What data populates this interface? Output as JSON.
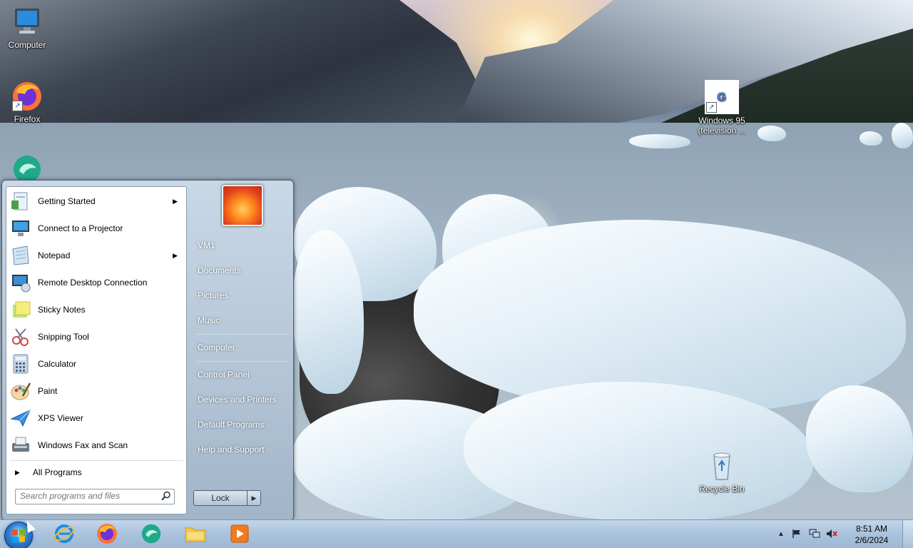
{
  "desktop": {
    "icons": [
      {
        "label": "Computer",
        "icon": "computer-icon"
      },
      {
        "label": "Firefox",
        "icon": "firefox-icon"
      },
      {
        "label": "",
        "icon": "app-bubble-icon"
      },
      {
        "label": "Windows 95 (television ...",
        "icon": "google-shortcut-icon"
      },
      {
        "label": "Recycle Bin",
        "icon": "recycle-bin-icon"
      }
    ]
  },
  "start_menu": {
    "programs": [
      {
        "label": "Getting Started",
        "icon": "getting-started-icon",
        "submenu": true
      },
      {
        "label": "Connect to a Projector",
        "icon": "projector-icon",
        "submenu": false
      },
      {
        "label": "Notepad",
        "icon": "notepad-icon",
        "submenu": true
      },
      {
        "label": "Remote Desktop Connection",
        "icon": "remote-desktop-icon",
        "submenu": false
      },
      {
        "label": "Sticky Notes",
        "icon": "sticky-notes-icon",
        "submenu": false
      },
      {
        "label": "Snipping Tool",
        "icon": "snipping-tool-icon",
        "submenu": false
      },
      {
        "label": "Calculator",
        "icon": "calculator-icon",
        "submenu": false
      },
      {
        "label": "Paint",
        "icon": "paint-icon",
        "submenu": false
      },
      {
        "label": "XPS Viewer",
        "icon": "xps-viewer-icon",
        "submenu": false
      },
      {
        "label": "Windows Fax and Scan",
        "icon": "fax-scan-icon",
        "submenu": false
      }
    ],
    "all_programs": "All Programs",
    "search_placeholder": "Search programs and files",
    "right_links": [
      "VM1",
      "Documents",
      "Pictures",
      "Music",
      "Computer",
      "Control Panel",
      "Devices and Printers",
      "Default Programs",
      "Help and Support"
    ],
    "lock_label": "Lock"
  },
  "taskbar": {
    "pinned": [
      {
        "name": "internet-explorer",
        "icon": "ie-icon"
      },
      {
        "name": "firefox",
        "icon": "firefox-icon"
      },
      {
        "name": "app-bubble",
        "icon": "app-bubble-icon"
      },
      {
        "name": "file-explorer",
        "icon": "folder-icon"
      },
      {
        "name": "media-player",
        "icon": "media-player-icon"
      }
    ],
    "clock_time": "8:51 AM",
    "clock_date": "2/6/2024"
  }
}
